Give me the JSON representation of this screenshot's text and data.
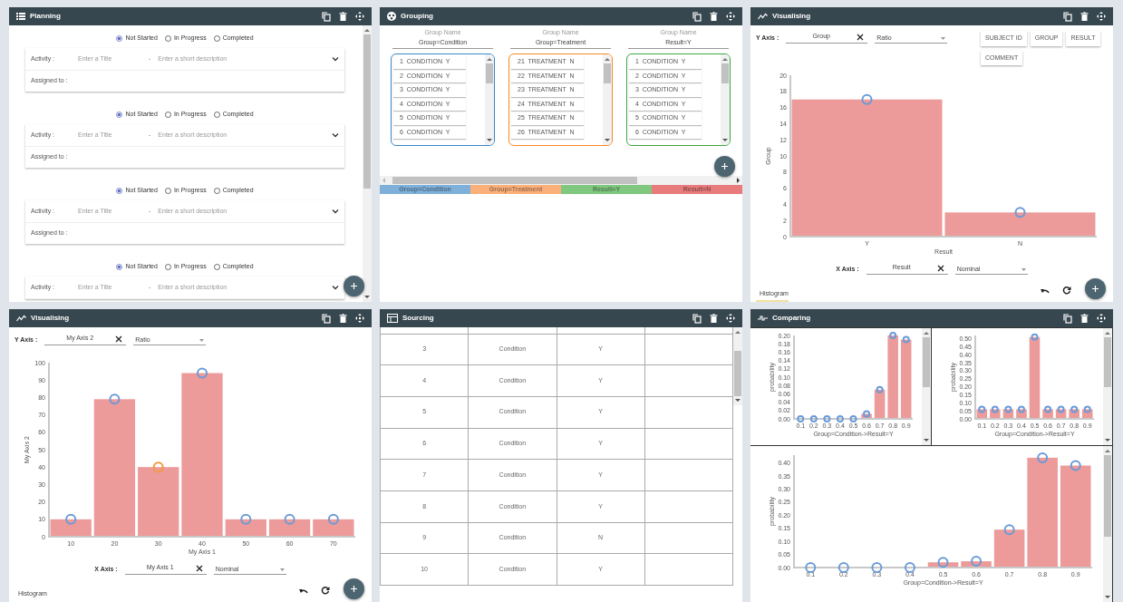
{
  "panels": [
    {
      "kind": "planning",
      "title": "Planning",
      "tasks": [
        {
          "statuses": [
            {
              "label": "Not Started",
              "selected": true
            },
            {
              "label": "In Progress",
              "selected": false
            },
            {
              "label": "Completed",
              "selected": false
            }
          ],
          "activity_label": "Activity :",
          "title_placeholder": "Enter a Title",
          "separator": "-",
          "description_placeholder": "Enter a short description",
          "assigned_label": "Assigned to :"
        },
        {
          "statuses": [
            {
              "label": "Not Started",
              "selected": true
            },
            {
              "label": "In Progress",
              "selected": false
            },
            {
              "label": "Completed",
              "selected": false
            }
          ],
          "activity_label": "Activity :",
          "title_placeholder": "Enter a Title",
          "separator": "-",
          "description_placeholder": "Enter a short description",
          "assigned_label": "Assigned to :"
        },
        {
          "statuses": [
            {
              "label": "Not Started",
              "selected": true
            },
            {
              "label": "In Progress",
              "selected": false
            },
            {
              "label": "Completed",
              "selected": false
            }
          ],
          "activity_label": "Activity :",
          "title_placeholder": "Enter a Title",
          "separator": "-",
          "description_placeholder": "Enter a short description",
          "assigned_label": "Assigned to :"
        },
        {
          "statuses": [
            {
              "label": "Not Started",
              "selected": true
            },
            {
              "label": "In Progress",
              "selected": false
            },
            {
              "label": "Completed",
              "selected": false
            }
          ],
          "activity_label": "Activity :",
          "title_placeholder": "Enter a Title",
          "separator": "-",
          "description_placeholder": "Enter a short description"
        }
      ]
    },
    {
      "kind": "grouping",
      "title": "Grouping",
      "groups": [
        {
          "caption": "Group Name",
          "name": "Group=Condition",
          "color": "#3a86c8",
          "items": [
            "1  CONDITION  Y",
            "2  CONDITION  Y",
            "3  CONDITION  Y",
            "4  CONDITION  Y",
            "5  CONDITION  Y",
            "6  CONDITION  Y"
          ]
        },
        {
          "caption": "Group Name",
          "name": "Group=Treatment",
          "color": "#f58a25",
          "items": [
            "21  TREATMENT  N",
            "22  TREATMENT  N",
            "23  TREATMENT  N",
            "24  TREATMENT  N",
            "25  TREATMENT  N",
            "26  TREATMENT  N"
          ]
        },
        {
          "caption": "Group Name",
          "name": "Result=Y",
          "color": "#3ea63e",
          "items": [
            "1  CONDITION  Y",
            "2  CONDITION  Y",
            "3  CONDITION  Y",
            "4  CONDITION  Y",
            "5  CONDITION  Y",
            "6  CONDITION  Y"
          ]
        }
      ],
      "legend": [
        {
          "label": "Group=Condition",
          "color": "#7eb0d9"
        },
        {
          "label": "Group=Treatment",
          "color": "#fbb07a"
        },
        {
          "label": "Result=Y",
          "color": "#80c780"
        },
        {
          "label": "Result=N",
          "color": "#e87c7c"
        }
      ]
    },
    {
      "kind": "visualising",
      "title": "Visualising",
      "y_axis": {
        "label": "Y Axis :",
        "field": "Group",
        "scale": "Ratio"
      },
      "variables": [
        "SUBJECT ID",
        "GROUP",
        "RESULT",
        "COMMENT"
      ],
      "chart_data": {
        "type": "bar",
        "xlabel": "Result",
        "ylabel": "Group",
        "categories": [
          "Y",
          "N"
        ],
        "series": [
          {
            "color": "#ec9a9a",
            "values": [
              17,
              3
            ]
          }
        ],
        "ylim": [
          0,
          20
        ],
        "yticks": [
          0,
          2,
          4,
          6,
          8,
          10,
          12,
          14,
          16,
          18,
          20
        ]
      },
      "x_axis": {
        "label": "X Axis :",
        "field": "Result",
        "scale": "Nominal"
      },
      "tabs": [
        {
          "label": "Histogram",
          "selected": true
        }
      ]
    },
    {
      "kind": "visualising",
      "title": "Visualising",
      "y_axis": {
        "label": "Y Axis :",
        "field": "My Axis 2",
        "scale": "Ratio"
      },
      "chart_data": {
        "type": "bar",
        "xlabel": "My Axis 1",
        "ylabel": "My Axis 2",
        "categories": [
          "10",
          "20",
          "30",
          "40",
          "50",
          "60",
          "70"
        ],
        "series": [
          {
            "color": "#ec9a9a",
            "values": [
              10,
              79,
              40,
              94,
              10,
              10,
              10
            ]
          }
        ],
        "ylim": [
          0,
          100
        ],
        "yticks": [
          0,
          10,
          20,
          30,
          40,
          50,
          60,
          70,
          80,
          90,
          100
        ]
      },
      "markers": [
        {
          "color": "#6a9bd8"
        },
        {
          "color": "#6a9bd8"
        },
        {
          "color": "#f39a3c"
        },
        {
          "color": "#6a9bd8"
        },
        {
          "color": "#6a9bd8"
        },
        {
          "color": "#6a9bd8"
        },
        {
          "color": "#6a9bd8"
        }
      ],
      "x_axis": {
        "label": "X Axis :",
        "field": "My Axis 1",
        "scale": "Nominal"
      },
      "tabs": [
        {
          "label": "Histogram",
          "selected": false
        }
      ]
    },
    {
      "kind": "sourcing",
      "title": "Sourcing",
      "rows": [
        {
          "cells": [
            "3",
            "Condition",
            "Y"
          ]
        },
        {
          "cells": [
            "4",
            "Condition",
            "Y"
          ]
        },
        {
          "cells": [
            "5",
            "Condition",
            "Y"
          ]
        },
        {
          "cells": [
            "6",
            "Condition",
            "Y"
          ]
        },
        {
          "cells": [
            "7",
            "Condition",
            "Y"
          ]
        },
        {
          "cells": [
            "8",
            "Condition",
            "Y"
          ]
        },
        {
          "cells": [
            "9",
            "Condition",
            "N"
          ]
        },
        {
          "cells": [
            "10",
            "Condition",
            "Y"
          ]
        }
      ]
    },
    {
      "kind": "comparing",
      "title": "Comparing",
      "charts": [
        {
          "chart_data": {
            "type": "bar",
            "xlabel": "Group=Condition->Result=Y",
            "ylabel": "probability",
            "categories": [
              "0.1",
              "0.2",
              "0.3",
              "0.4",
              "0.5",
              "0.6",
              "0.7",
              "0.8",
              "0.9"
            ],
            "series": [
              {
                "color": "#ec9a9a",
                "values": [
                  0,
                  0,
                  0,
                  0,
                  0,
                  0.012,
                  0.07,
                  0.2,
                  0.19
                ]
              }
            ],
            "ylim": [
              0,
              0.2
            ],
            "yticks": [
              {
                "value": 0,
                "label": "0.00"
              },
              {
                "value": 0.02,
                "label": "0.02"
              },
              {
                "value": 0.04,
                "label": "0.04"
              },
              {
                "value": 0.06,
                "label": "0.06"
              },
              {
                "value": 0.08,
                "label": "0.08"
              },
              {
                "value": 0.1,
                "label": "0.10"
              },
              {
                "value": 0.12,
                "label": "0.12"
              },
              {
                "value": 0.14,
                "label": "0.14"
              },
              {
                "value": 0.16,
                "label": "0.16"
              },
              {
                "value": 0.18,
                "label": "0.18"
              },
              {
                "value": 0.2,
                "label": "0.20"
              }
            ]
          }
        },
        {
          "chart_data": {
            "type": "bar",
            "xlabel": "Group=Condition->Result=Y",
            "ylabel": "probability",
            "categories": [
              "0.1",
              "0.2",
              "0.3",
              "0.4",
              "0.5",
              "0.6",
              "0.7",
              "0.8",
              "0.9"
            ],
            "series": [
              {
                "color": "#ec9a9a",
                "values": [
                  0.06,
                  0.06,
                  0.06,
                  0.06,
                  0.51,
                  0.06,
                  0.06,
                  0.06,
                  0.06
                ]
              }
            ],
            "ylim": [
              0,
              0.52
            ],
            "yticks": [
              {
                "value": 0,
                "label": "0.00"
              },
              {
                "value": 0.05,
                "label": "0.05"
              },
              {
                "value": 0.1,
                "label": "0.10"
              },
              {
                "value": 0.15,
                "label": "0.15"
              },
              {
                "value": 0.2,
                "label": "0.20"
              },
              {
                "value": 0.25,
                "label": "0.25"
              },
              {
                "value": 0.3,
                "label": "0.30"
              },
              {
                "value": 0.35,
                "label": "0.35"
              },
              {
                "value": 0.4,
                "label": "0.40"
              },
              {
                "value": 0.45,
                "label": "0.45"
              },
              {
                "value": 0.5,
                "label": "0.50"
              }
            ]
          }
        },
        {
          "chart_data": {
            "type": "bar",
            "xlabel": "Group=Condition->Result=Y",
            "ylabel": "probability",
            "categories": [
              "0.1",
              "0.2",
              "0.3",
              "0.4",
              "0.5",
              "0.6",
              "0.7",
              "0.8",
              "0.9"
            ],
            "series": [
              {
                "color": "#ec9a9a",
                "values": [
                  0,
                  0,
                  0,
                  0,
                  0.02,
                  0.024,
                  0.145,
                  0.42,
                  0.39
                ]
              }
            ],
            "ylim": [
              0,
              0.43
            ],
            "yticks": [
              {
                "value": 0,
                "label": "0.00"
              },
              {
                "value": 0.05,
                "label": "0.05"
              },
              {
                "value": 0.1,
                "label": "0.10"
              },
              {
                "value": 0.15,
                "label": "0.15"
              },
              {
                "value": 0.2,
                "label": "0.20"
              },
              {
                "value": 0.25,
                "label": "0.25"
              },
              {
                "value": 0.3,
                "label": "0.30"
              },
              {
                "value": 0.35,
                "label": "0.35"
              },
              {
                "value": 0.4,
                "label": "0.40"
              }
            ]
          }
        }
      ]
    }
  ]
}
